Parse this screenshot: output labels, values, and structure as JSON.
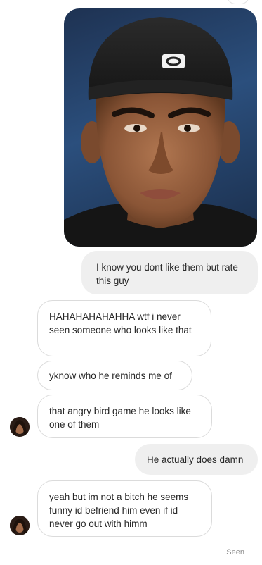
{
  "thread": {
    "messages": [
      {
        "from": "me",
        "text": "I know you dont like them but rate this guy"
      },
      {
        "from": "them",
        "text": "HAHAHAHAHAHHA wtf i never seen someone who looks like that"
      },
      {
        "from": "them",
        "text": "yknow who he reminds me of"
      },
      {
        "from": "them",
        "text": "that angry bird game he looks like one of them"
      },
      {
        "from": "me",
        "text": "He actually does damn"
      },
      {
        "from": "them",
        "text": "yeah but im not a bitch he seems funny id befriend him even if id never go out with himm"
      }
    ],
    "seen_label": "Seen"
  },
  "colors": {
    "outgoing_bubble": "#efefef",
    "incoming_border": "#dbdbdb",
    "seen_text": "#8e8e8e"
  }
}
